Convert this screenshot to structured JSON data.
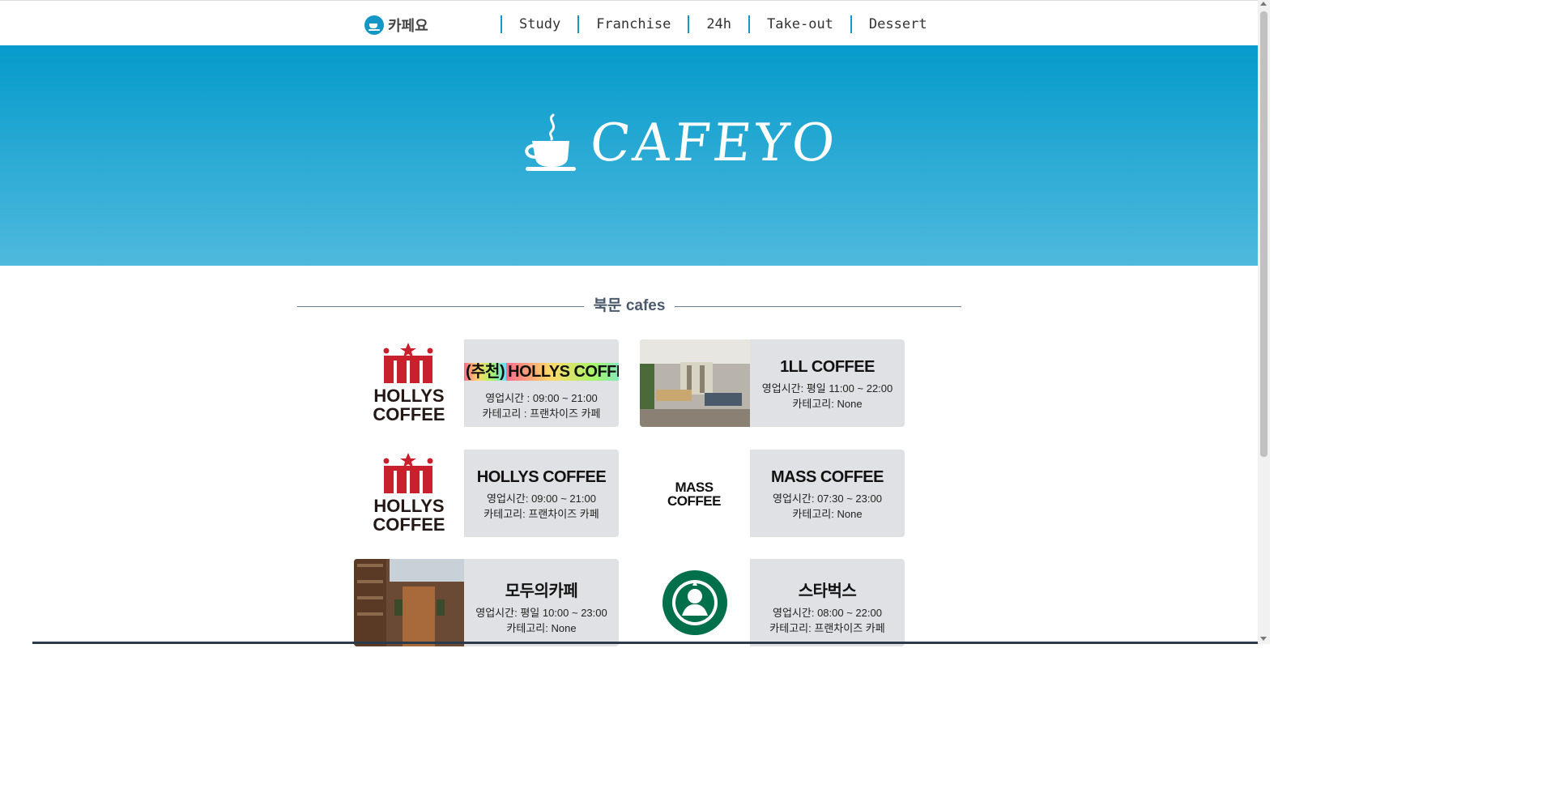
{
  "header": {
    "logo_text": "카페요",
    "nav": [
      "Study",
      "Franchise",
      "24h",
      "Take-out",
      "Dessert"
    ]
  },
  "hero": {
    "title": "CAFEYO"
  },
  "section": {
    "title": "북문 cafes"
  },
  "cards": [
    {
      "tag": "(추천)",
      "name": "HOLLYS COFFEE",
      "hours": "영업시간 : 09:00 ~ 21:00",
      "category": "카테고리 : 프랜차이즈 카페",
      "image": "hollys-logo",
      "brand_logo": "HOLLYS COFFEE"
    },
    {
      "name": "1LL COFFEE",
      "hours": "영업시간: 평일 11:00 ~ 22:00",
      "category": "카테고리: None",
      "image": "cafe-interior-photo"
    },
    {
      "name": "HOLLYS COFFEE",
      "hours": "영업시간: 09:00 ~ 21:00",
      "category": "카테고리: 프랜차이즈 카페",
      "image": "hollys-logo",
      "brand_logo": "HOLLYS COFFEE"
    },
    {
      "name": "MASS COFFEE",
      "hours": "영업시간: 07:30 ~ 23:00",
      "category": "카테고리: None",
      "image": "mass-coffee-logo",
      "brand_logo": "MASS COFFEE"
    },
    {
      "name": "모두의카페",
      "hours": "영업시간: 평일 10:00 ~ 23:00",
      "category": "카테고리: None",
      "image": "library-cafe-photo"
    },
    {
      "name": "스타벅스",
      "hours": "영업시간: 08:00 ~ 22:00",
      "category": "카테고리: 프랜차이즈 카페",
      "image": "starbucks-logo"
    }
  ],
  "colors": {
    "accent": "#1496c6",
    "hero_top": "#059bcb",
    "hero_bottom": "#4fb9dd",
    "card_bg": "#dfe1e4",
    "hollys_red": "#c8202c",
    "starbucks_green": "#00704a"
  }
}
